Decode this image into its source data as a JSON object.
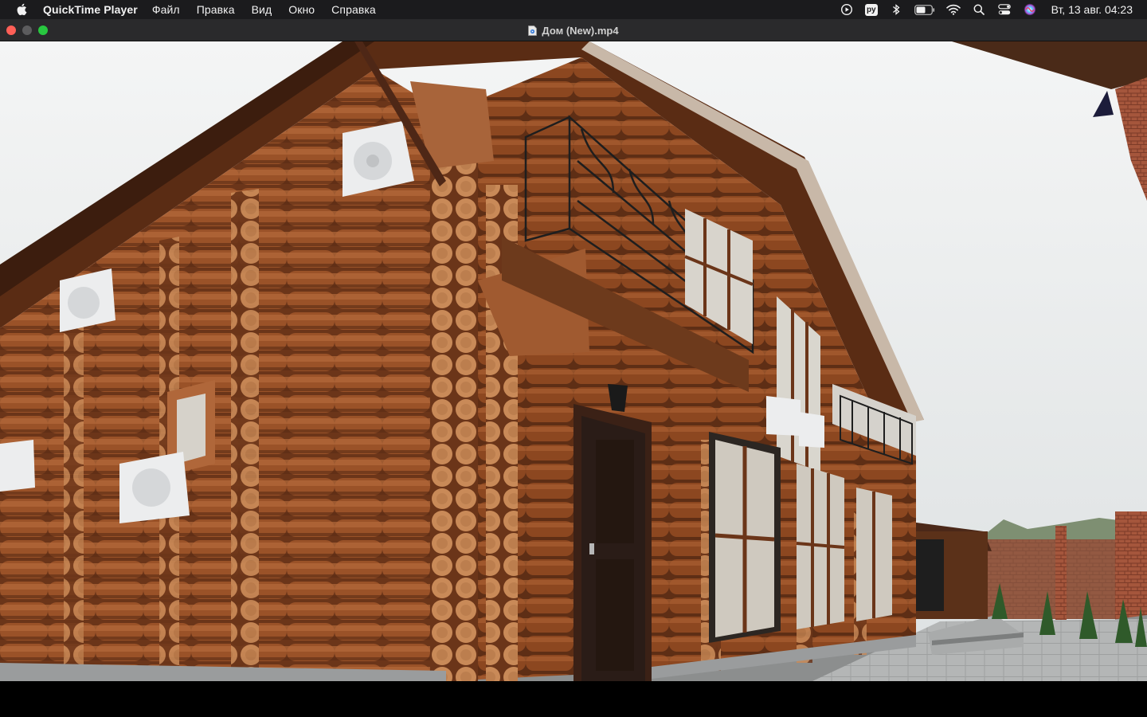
{
  "menubar": {
    "apple_icon": "apple-logo-icon",
    "app_name": "QuickTime Player",
    "menus": [
      "Файл",
      "Правка",
      "Вид",
      "Окно",
      "Справка"
    ],
    "status": {
      "input_source": "ру",
      "datetime": "Вт, 13 авг.  04:23"
    }
  },
  "window": {
    "title": "Дом (New).mp4",
    "doc_icon": "video-document-icon"
  },
  "video": {
    "content": "log-house-frame"
  },
  "colors": {
    "menubar_bg": "#1b1b1d",
    "titlebar_bg": "#2a2a2c",
    "close": "#ff5f57",
    "minimize": "#5c5c5e",
    "zoom": "#28c840",
    "wood": "#8a4a22"
  }
}
